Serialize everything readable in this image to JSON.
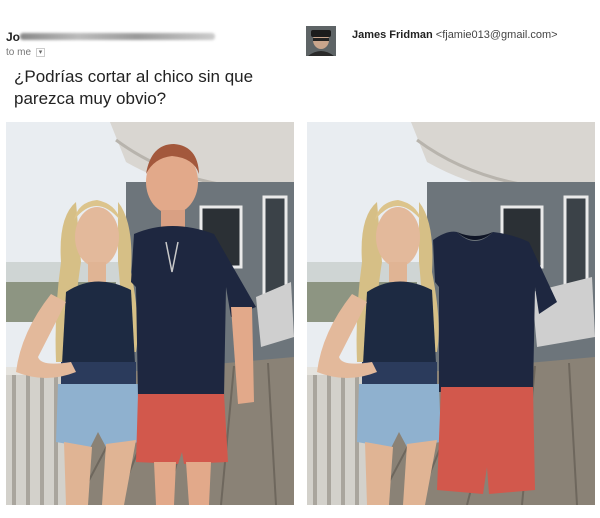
{
  "original_email": {
    "sender_initials": "Jo",
    "to_label": "to me",
    "to_caret": "▾",
    "message": "¿Podrías cortar al chico sin que parezca muy obvio?"
  },
  "reply": {
    "sender_name": "James Fridman",
    "sender_email": "<fjamie013@gmail.com>"
  },
  "images": {
    "original_photo": "photo-couple-on-balcony",
    "edited_photo": "photo-couple-boy-head-removed"
  },
  "colors": {
    "shirt": "#1e2740",
    "shorts": "#d2584c",
    "sky": "#e9edf1",
    "deck": "#8a8276"
  }
}
